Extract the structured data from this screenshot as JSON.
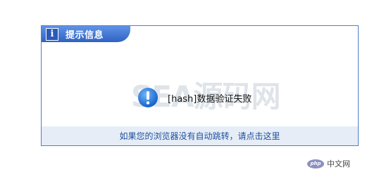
{
  "dialog": {
    "title": "提示信息",
    "title_icon": "info-icon",
    "info_glyph": "i",
    "message": "[hash]数据验证失败",
    "message_icon": "exclamation-alert-icon",
    "watermark": "SEA源码网",
    "redirect_link": "如果您的浏览器没有自动跳转，请点击这里"
  },
  "badge": {
    "logo_text": "php",
    "site_name": "中文网"
  },
  "colors": {
    "accent": "#2f62c4",
    "link": "#1f4f9a",
    "footer_bg": "#e6edf7"
  }
}
